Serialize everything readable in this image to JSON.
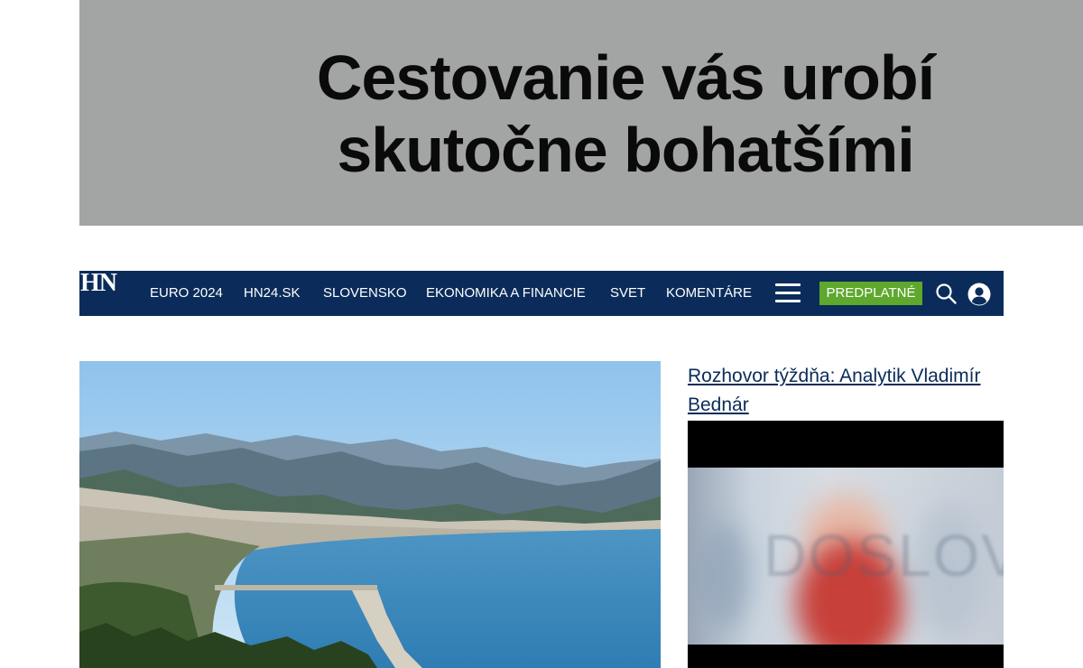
{
  "banner": {
    "headline_line1": "Cestovanie vás urobí",
    "headline_line2": "skutočne bohatšími",
    "background": "#a3a5a4"
  },
  "navbar": {
    "background": "#0b2c5a",
    "logo": "HN",
    "items": [
      {
        "label": "EURO 2024"
      },
      {
        "label": "HN24.SK"
      },
      {
        "label": "SLOVENSKO"
      },
      {
        "label": "EKONOMIKA A FINANCIE"
      },
      {
        "label": "SVET"
      },
      {
        "label": "KOMENTÁRE"
      }
    ],
    "menu_icon": "hamburger-icon",
    "subscribe_label": "PREDPLATNÉ",
    "subscribe_color": "#5ea82d",
    "search_icon": "search-icon",
    "user_icon": "user-icon"
  },
  "article": {
    "hero_image": "coastal-bay-photo"
  },
  "video_block": {
    "title": "Rozhovor týždňa: Analytik Vladimír Bednár",
    "watermark": "DOSLOVA"
  }
}
